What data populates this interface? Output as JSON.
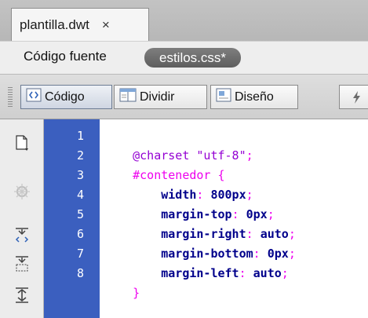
{
  "document_tab": {
    "title": "plantilla.dwt",
    "close_glyph": "×"
  },
  "source_bar": {
    "label": "Código fuente",
    "related_file": "estilos.css*"
  },
  "toolbar": {
    "views": [
      {
        "label": "Código",
        "icon": "code-view-icon",
        "active": true
      },
      {
        "label": "Dividir",
        "icon": "split-view-icon",
        "active": false
      },
      {
        "label": "Diseño",
        "icon": "design-view-icon",
        "active": false
      }
    ]
  },
  "gutter_tools": [
    "open-documents-icon",
    "snippet-icon",
    "collapse-full-tag-icon",
    "collapse-selection-icon",
    "expand-all-icon"
  ],
  "editor": {
    "line_numbers": [
      "1",
      "2",
      "3",
      "4",
      "5",
      "6",
      "7",
      "8"
    ],
    "lines": [
      [
        {
          "t": "@charset ",
          "c": "at"
        },
        {
          "t": "\"utf-8\"",
          "c": "str"
        },
        {
          "t": ";",
          "c": "pun"
        }
      ],
      [
        {
          "t": "#contenedor ",
          "c": "sel"
        },
        {
          "t": "{",
          "c": "pun"
        }
      ],
      [
        {
          "t": "    width",
          "c": "prop"
        },
        {
          "t": ": ",
          "c": "pun"
        },
        {
          "t": "800px",
          "c": "val"
        },
        {
          "t": ";",
          "c": "pun"
        }
      ],
      [
        {
          "t": "    margin-top",
          "c": "prop"
        },
        {
          "t": ": ",
          "c": "pun"
        },
        {
          "t": "0px",
          "c": "val"
        },
        {
          "t": ";",
          "c": "pun"
        }
      ],
      [
        {
          "t": "    margin-right",
          "c": "prop"
        },
        {
          "t": ": ",
          "c": "pun"
        },
        {
          "t": "auto",
          "c": "val"
        },
        {
          "t": ";",
          "c": "pun"
        }
      ],
      [
        {
          "t": "    margin-bottom",
          "c": "prop"
        },
        {
          "t": ": ",
          "c": "pun"
        },
        {
          "t": "0px",
          "c": "val"
        },
        {
          "t": ";",
          "c": "pun"
        }
      ],
      [
        {
          "t": "    margin-left",
          "c": "prop"
        },
        {
          "t": ": ",
          "c": "pun"
        },
        {
          "t": "auto",
          "c": "val"
        },
        {
          "t": ";",
          "c": "pun"
        }
      ],
      [
        {
          "t": "}",
          "c": "pun"
        }
      ]
    ]
  },
  "colors": {
    "line_number_bg": "#3b5fbf",
    "at_rule": "#9400d3",
    "selector": "#ee00ee",
    "property": "#00008b"
  }
}
